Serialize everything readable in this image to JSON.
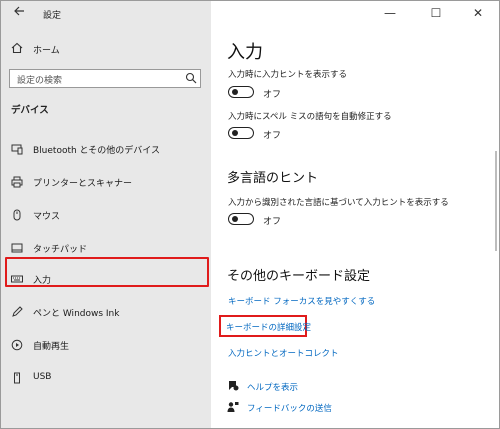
{
  "window": {
    "title": "設定",
    "back_icon": "back-arrow-icon",
    "minimize_glyph": "—",
    "maximize_glyph": "☐",
    "close_glyph": "✕"
  },
  "sidebar": {
    "home_label": "ホーム",
    "search_placeholder": "設定の検索",
    "section_title": "デバイス",
    "items": [
      {
        "label": "Bluetooth とその他のデバイス",
        "icon": "bluetooth-devices-icon"
      },
      {
        "label": "プリンターとスキャナー",
        "icon": "printer-icon"
      },
      {
        "label": "マウス",
        "icon": "mouse-icon"
      },
      {
        "label": "タッチパッド",
        "icon": "touchpad-icon"
      },
      {
        "label": "入力",
        "icon": "keyboard-icon",
        "selected": true
      },
      {
        "label": "ペンと Windows Ink",
        "icon": "pen-icon"
      },
      {
        "label": "自動再生",
        "icon": "autoplay-icon"
      },
      {
        "label": "USB",
        "icon": "usb-icon"
      }
    ]
  },
  "main": {
    "title": "入力",
    "settings": [
      {
        "label": "入力時に入力ヒントを表示する",
        "state": "オフ"
      },
      {
        "label": "入力時にスペル ミスの語句を自動修正する",
        "state": "オフ"
      }
    ],
    "multilang": {
      "heading": "多言語のヒント",
      "label": "入力から識別された言語に基づいて入力ヒントを表示する",
      "state": "オフ"
    },
    "other": {
      "heading": "その他のキーボード設定",
      "links": [
        "キーボード フォーカスを見やすくする",
        "キーボードの詳細設定",
        "入力ヒントとオートコレクト"
      ]
    },
    "help": {
      "show_help": "ヘルプを表示",
      "feedback": "フィードバックの送信"
    }
  },
  "colors": {
    "accent_link": "#0067c0",
    "highlight_red": "#e01b1b",
    "sidebar_bg": "#e8e8e8"
  }
}
